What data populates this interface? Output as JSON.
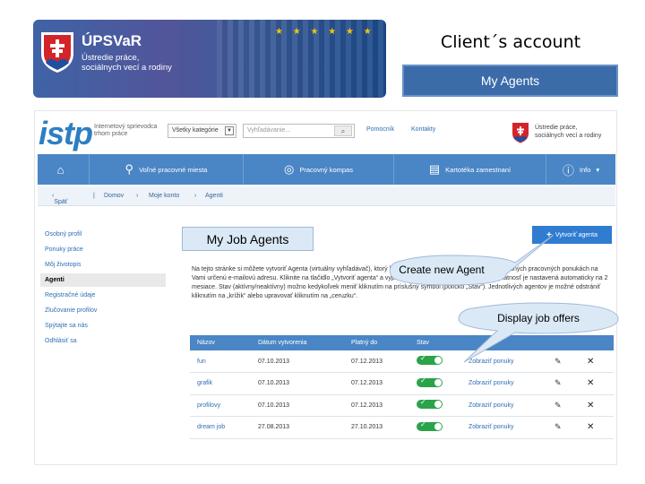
{
  "banner": {
    "org_name": "ÚPSVaR",
    "org_subtitle": "Ústredie práce,\nsociálnych vecí a rodiny",
    "stars": "★ ★ ★ ★ ★ ★"
  },
  "slide": {
    "title": "Client´s account",
    "box_label": "My Agents"
  },
  "header": {
    "logo": "istp",
    "guide_text": "Internetový sprievodca\ntrhom práce",
    "category_select": "Všetky kategórie",
    "search_placeholder": "Vyhľadávanie...",
    "link_help": "Pomocník",
    "link_contacts": "Kontakty",
    "org_text": "Ústredie práce,\nsociálnych vecí a rodiny"
  },
  "nav": {
    "items": [
      {
        "label": "",
        "icon": "home-icon"
      },
      {
        "label": "Voľné pracovné miesta",
        "icon": "search-icon"
      },
      {
        "label": "Pracovný kompas",
        "icon": "compass-icon"
      },
      {
        "label": "Kartotéka zamestnaní",
        "icon": "book-icon"
      },
      {
        "label": "Info",
        "icon": "info-icon"
      }
    ]
  },
  "breadcrumb": {
    "back": "Späť",
    "items": [
      "Domov",
      "Moje konto",
      "Agenti"
    ]
  },
  "sidebar": {
    "items": [
      {
        "label": "Osobný profil"
      },
      {
        "label": "Ponuky práce"
      },
      {
        "label": "Môj životopis"
      },
      {
        "label": "Agenti",
        "active": true
      },
      {
        "label": "Registračné údaje"
      },
      {
        "label": "Zlučovanie profilov"
      },
      {
        "label": "Spýtajte sa nás"
      },
      {
        "label": "Odhlásiť sa"
      }
    ]
  },
  "main": {
    "create_button": "Vytvoriť agenta",
    "intro": "Na tejto stránke si môžete vytvoriť Agenta (virtuálny vyhľadávač), ktorý bude automaticky zasielať informácie o vhodných pracovných ponukách na Vami určenú e-mailovú adresu. Kliknite na tlačidlo „Vytvoriť agenta“ a vyplnením kritérií na vyhľadávanie. Jeho platnosť je nastavená automaticky na 2 mesiace. Stav (aktívny/neaktívny) možno kedykoľvek meniť kliknutím na príslušný symbol (políčko „Stav“). Jednotlivých agentov je možné odstrániť kliknutím na „krížik“ alebo upravovať kliknutím na „ceruzku“.",
    "table": {
      "headers": [
        "Názov",
        "Dátum vytvorenia",
        "Platný do",
        "Stav",
        "",
        "",
        ""
      ],
      "rows": [
        {
          "name": "fun",
          "created": "07.10.2013",
          "valid": "07.12.2013",
          "action": "Zobraziť ponuky"
        },
        {
          "name": "grafik",
          "created": "07.10.2013",
          "valid": "07.12.2013",
          "action": "Zobraziť ponuky"
        },
        {
          "name": "profilovy",
          "created": "07.10.2013",
          "valid": "07.12.2013",
          "action": "Zobraziť ponuky"
        },
        {
          "name": "dream job",
          "created": "27.08.2013",
          "valid": "27.10.2013",
          "action": "Zobraziť ponuky"
        }
      ]
    }
  },
  "callouts": {
    "my_job_agents": "My Job Agents",
    "create_new_agent": "Create new Agent",
    "display_job_offers": "Display job offers"
  },
  "colors": {
    "accent_blue": "#4a86c5",
    "link_blue": "#2d6fb5",
    "toggle_green": "#2aa34a",
    "callout_fill": "#dbe9f7"
  }
}
